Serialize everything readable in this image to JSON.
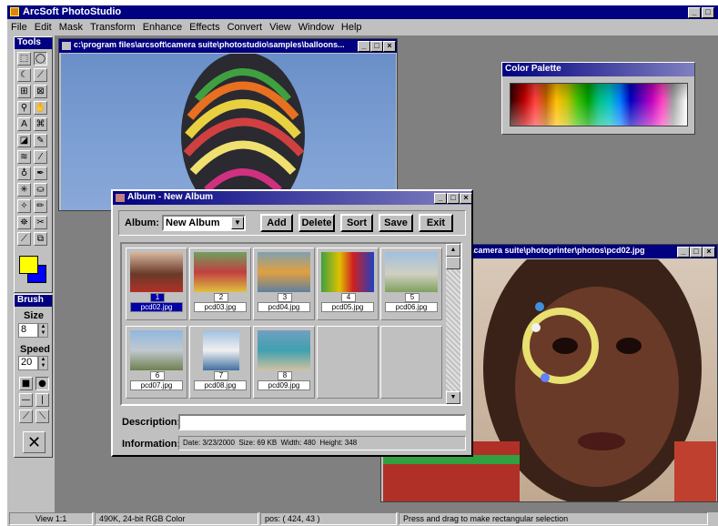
{
  "app": {
    "title": "ArcSoft PhotoStudio"
  },
  "menu": [
    "File",
    "Edit",
    "Mask",
    "Transform",
    "Enhance",
    "Effects",
    "Convert",
    "View",
    "Window",
    "Help"
  ],
  "tools": {
    "title": "Tools",
    "brush_title": "Brush",
    "size_label": "Size",
    "size_value": "8",
    "speed_label": "Speed",
    "speed_value": "20"
  },
  "photo_window": {
    "title": "c:\\program files\\arcsoft\\camera suite\\photostudio\\samples\\balloons..."
  },
  "palette": {
    "title": "Color Palette"
  },
  "album": {
    "title": "Album - New Album",
    "album_label": "Album:",
    "album_value": "New Album",
    "buttons": {
      "add": "Add",
      "delete": "Delete",
      "sort": "Sort",
      "save": "Save",
      "exit": "Exit"
    },
    "thumbs": [
      {
        "num": "1",
        "name": "pcd02.jpg"
      },
      {
        "num": "2",
        "name": "pcd03.jpg"
      },
      {
        "num": "3",
        "name": "pcd04.jpg"
      },
      {
        "num": "4",
        "name": "pcd05.jpg"
      },
      {
        "num": "5",
        "name": "pcd06.jpg"
      },
      {
        "num": "6",
        "name": "pcd07.jpg"
      },
      {
        "num": "7",
        "name": "pcd08.jpg"
      },
      {
        "num": "8",
        "name": "pcd09.jpg"
      }
    ],
    "description_label": "Description:",
    "description_value": "",
    "info_label": "Information:",
    "info_value": "Date: 3/23/2000  Size: 69 KB  Width: 480  Height: 348"
  },
  "printer_window": {
    "title": "a\\camera suite\\photoprinter\\photos\\pcd02.jpg"
  },
  "status": {
    "view": "View 1:1",
    "info": "490K, 24-bit RGB Color",
    "pos": "pos: ( 424, 43 )",
    "hint": "Press and drag to make rectangular selection"
  },
  "colors": {
    "title_blue": "#000080",
    "face": "#c0c0c0",
    "workspace": "#808080",
    "fg": "#ffff00",
    "bg": "#0000ff"
  }
}
